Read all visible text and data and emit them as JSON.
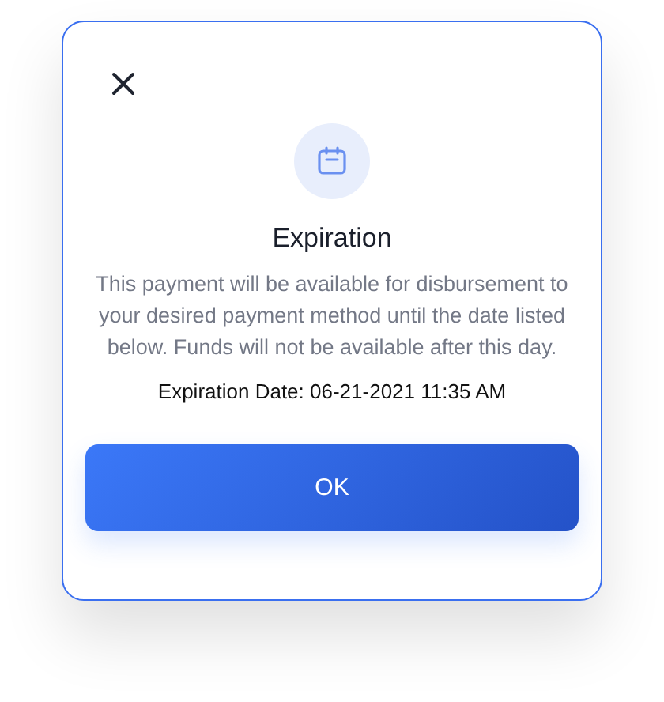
{
  "dialog": {
    "title": "Expiration",
    "message": "This payment will be available for disbursement to your desired payment method until the date listed below. Funds will not be available after this day.",
    "detail": "Expiration Date: 06-21-2021 11:35 AM",
    "button": "OK"
  }
}
